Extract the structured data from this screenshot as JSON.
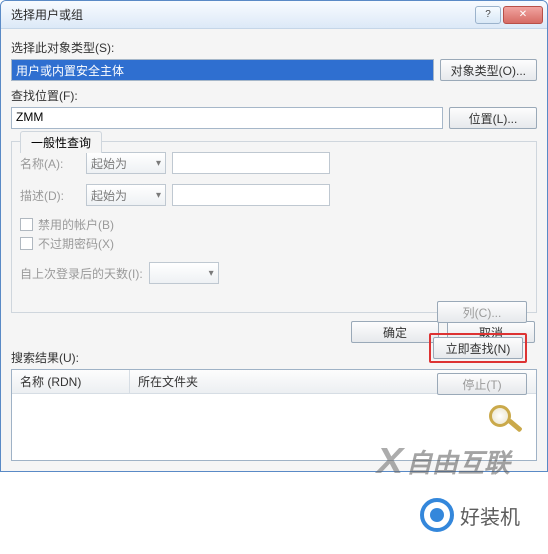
{
  "window": {
    "title": "选择用户或组"
  },
  "sections": {
    "object_type_label": "选择此对象类型(S):",
    "object_type_value": "用户或内置安全主体",
    "object_type_button": "对象类型(O)...",
    "location_label": "查找位置(F):",
    "location_value": "ZMM",
    "location_button": "位置(L)..."
  },
  "general": {
    "tab_label": "一般性查询",
    "name_label": "名称(A):",
    "name_combo": "起始为",
    "desc_label": "描述(D):",
    "desc_combo": "起始为",
    "chk_disabled": "禁用的帐户(B)",
    "chk_noexpire": "不过期密码(X)",
    "days_label": "自上次登录后的天数(I):"
  },
  "side_buttons": {
    "columns": "列(C)...",
    "search_now": "立即查找(N)",
    "stop": "停止(T)"
  },
  "bottom": {
    "ok": "确定",
    "cancel": "取消"
  },
  "results": {
    "label": "搜索结果(U):",
    "col1": "名称 (RDN)",
    "col2": "所在文件夹"
  },
  "watermark_text": "自由互联",
  "brand_text": "好装机"
}
